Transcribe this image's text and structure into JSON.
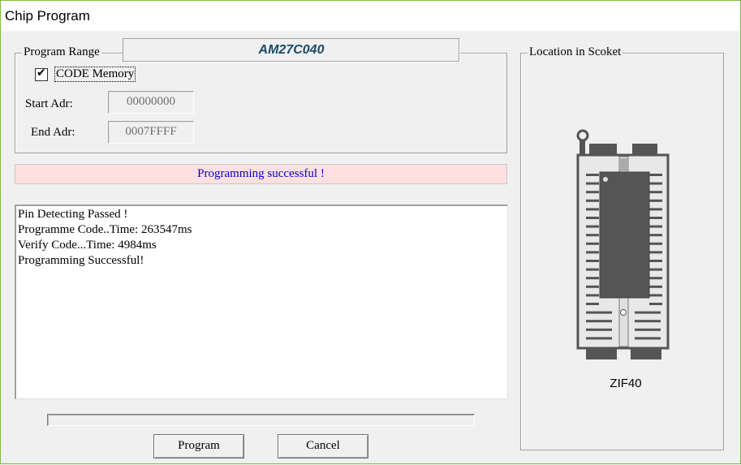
{
  "window": {
    "title": "Chip Program"
  },
  "program_range": {
    "legend": "Program Range",
    "chip_name": "AM27C040",
    "code_memory": {
      "checked": true,
      "checkmark": "✔",
      "label": "CODE Memory"
    },
    "start_addr": {
      "label": "Start Adr:",
      "value": "00000000"
    },
    "end_addr": {
      "label": "End Adr:",
      "value": "0007FFFF"
    }
  },
  "status": {
    "message": "Programming successful !",
    "background": "#ffe0e0",
    "text_color": "#0000c8"
  },
  "log": {
    "lines": [
      "Pin Detecting Passed !",
      "Programme Code..Time: 263547ms",
      "Verify Code...Time: 4984ms",
      "Programming Successful!"
    ]
  },
  "progress": {
    "value": 0
  },
  "buttons": {
    "program": "Program",
    "cancel": "Cancel"
  },
  "socket": {
    "legend": "Location in Scoket",
    "socket_name": "ZIF40",
    "pins_per_side": 20,
    "chip_pins_per_side": 16
  }
}
